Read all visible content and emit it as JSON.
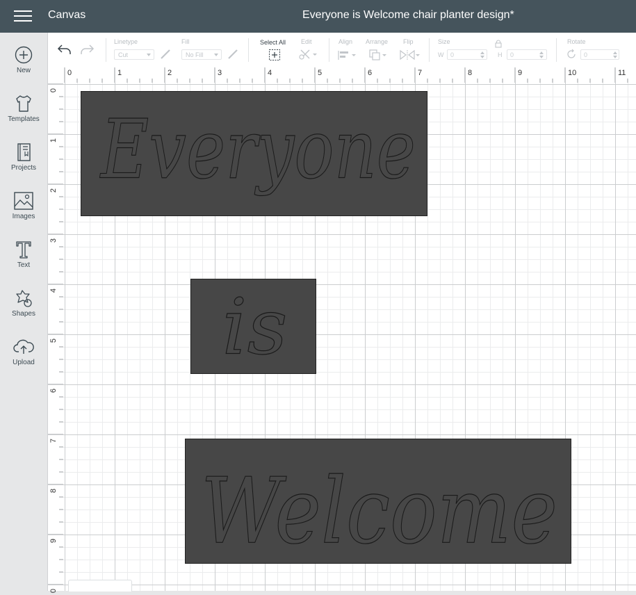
{
  "header": {
    "app_title": "Canvas",
    "doc_title": "Everyone is Welcome chair planter design*"
  },
  "sidebar": {
    "items": [
      {
        "label": "New",
        "icon": "plus-circle-icon"
      },
      {
        "label": "Templates",
        "icon": "tshirt-icon"
      },
      {
        "label": "Projects",
        "icon": "notebook-icon"
      },
      {
        "label": "Images",
        "icon": "image-icon"
      },
      {
        "label": "Text",
        "icon": "text-t-icon"
      },
      {
        "label": "Shapes",
        "icon": "shapes-icon"
      },
      {
        "label": "Upload",
        "icon": "cloud-upload-icon"
      }
    ]
  },
  "toolbar": {
    "linetype_label": "Linetype",
    "linetype_value": "Cut",
    "fill_label": "Fill",
    "fill_value": "No Fill",
    "select_all_label": "Select All",
    "edit_label": "Edit",
    "align_label": "Align",
    "arrange_label": "Arrange",
    "flip_label": "Flip",
    "size_label": "Size",
    "width_label": "W",
    "width_value": "0",
    "height_label": "H",
    "height_value": "0",
    "rotate_label": "Rotate",
    "rotate_value": "0"
  },
  "rulers": {
    "x_labels": [
      "0",
      "1",
      "2",
      "3",
      "4",
      "5",
      "6",
      "7",
      "8",
      "9",
      "10",
      "11"
    ],
    "y_labels": [
      "0",
      "1",
      "2",
      "3",
      "4",
      "5",
      "6",
      "7",
      "8",
      "9",
      "0"
    ]
  },
  "canvas": {
    "shapes": [
      {
        "text": "Everyone"
      },
      {
        "text": "is"
      },
      {
        "text": "Welcome"
      }
    ]
  },
  "colors": {
    "header_bg": "#45545c",
    "shape_fill": "#474747"
  }
}
